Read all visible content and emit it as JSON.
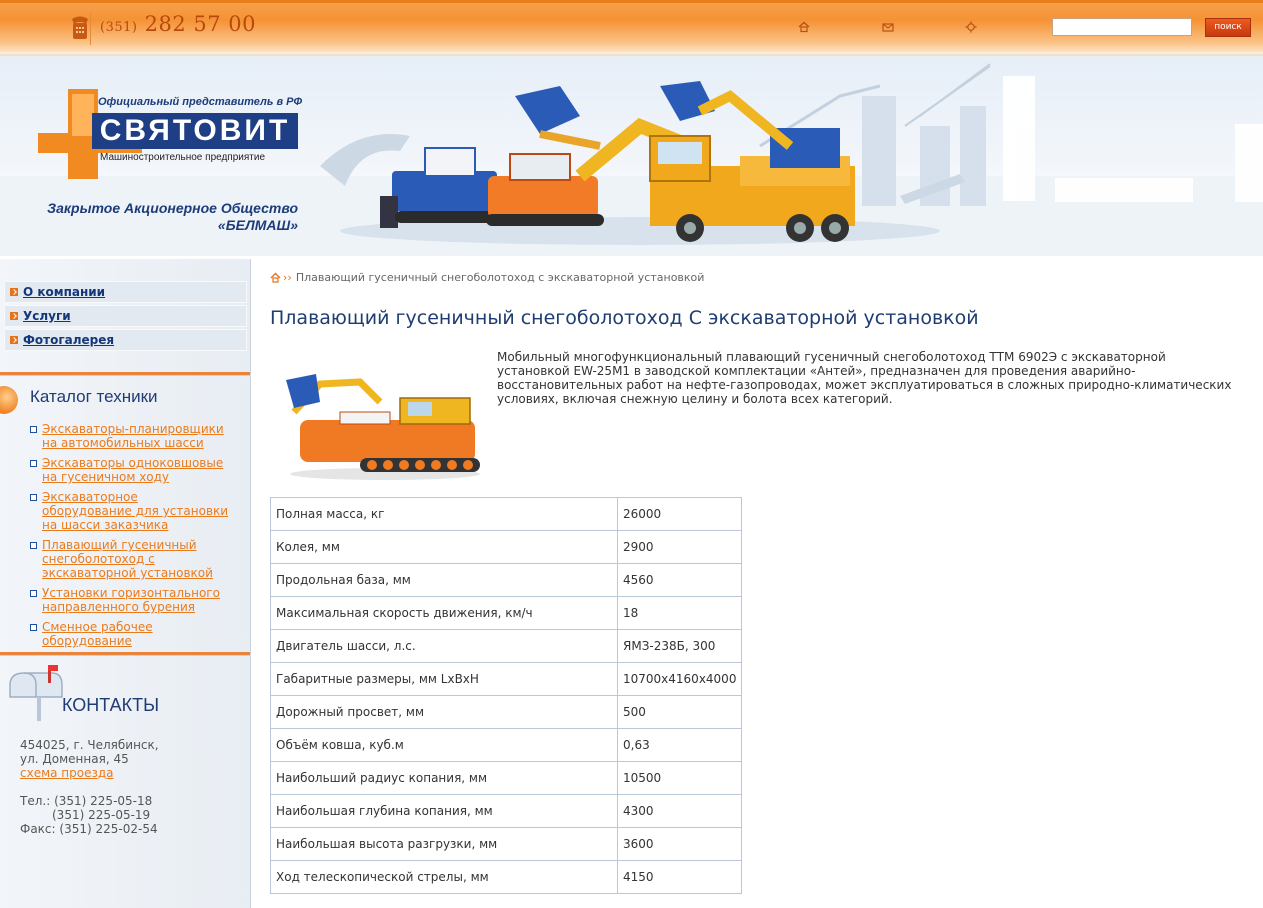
{
  "header": {
    "phone_code": "(351)",
    "phone_number": "282 57 00",
    "nav_icons": [
      "home-icon",
      "mail-icon",
      "sitemap-icon"
    ],
    "search_placeholder": "",
    "search_button": "поиск",
    "colors": {
      "accent": "#f59235",
      "brand_blue": "#1e3f86"
    }
  },
  "banner": {
    "logo_tagline": "Официальный представитель в РФ",
    "logo_word": "СВЯТОВИТ",
    "logo_subtitle": "Машиностроительное предприятие",
    "company_line1": "Закрытое Акционерное Общество",
    "company_line2": "«БЕЛМАШ»"
  },
  "sidebar": {
    "menu": [
      {
        "label": "О компании"
      },
      {
        "label": "Услуги"
      },
      {
        "label": "Фотогалерея"
      }
    ],
    "catalog_title": "Каталог техники",
    "catalog": [
      {
        "label": "Экскаваторы-планировщики на автомобильных шасси"
      },
      {
        "label": "Экскаваторы одноковшовые на гусеничном ходу"
      },
      {
        "label": "Экскаваторное оборудование для установки на шасси заказчика"
      },
      {
        "label": "Плавающий гусеничный снегоболотоход с экскаваторной установкой"
      },
      {
        "label": "Установки горизонтального направленного бурения"
      },
      {
        "label": "Сменное рабочее оборудование"
      }
    ],
    "contacts_title": "КОНТАКТЫ",
    "contacts": {
      "address1": "454025, г. Челябинск,",
      "address2": "ул. Доменная, 45",
      "map_link": "схема проезда",
      "tel_label": "Тел.:",
      "tel1": "(351) 225-05-18",
      "tel2": "(351) 225-05-19",
      "fax_label": "Факс:",
      "fax": "(351) 225-02-54"
    }
  },
  "main": {
    "breadcrumb_arrow": "››",
    "breadcrumb": "Плавающий гусеничный снегоболотоход с экскаваторной установкой",
    "title": "Плавающий гусеничный снегоболотоход С экскаваторной установкой",
    "intro": "Мобильный многофункциональный плавающий  гусеничный снегоболотоход ТТМ 6902Э с экскаваторной установкой EW-25M1 в заводской комплектации «Антей», предназначен для проведения аварийно-восстановительных работ на нефте-газопроводах, может эксплуатироваться в сложных природно-климатических условиях, включая снежную целину и болота всех категорий.",
    "specs": [
      {
        "key": "Полная масса, кг",
        "value": "26000"
      },
      {
        "key": "Колея, мм",
        "value": "2900"
      },
      {
        "key": "Продольная база, мм",
        "value": "4560"
      },
      {
        "key": "Максимальная скорость движения, км/ч",
        "value": "18"
      },
      {
        "key": "Двигатель шасси, л.с.",
        "value": "ЯМЗ-238Б, 300"
      },
      {
        "key": "Габаритные размеры, мм LxBxH",
        "value": "10700x4160x4000"
      },
      {
        "key": "Дорожный просвет, мм",
        "value": "500"
      },
      {
        "key": "Объём ковша, куб.м",
        "value": "0,63"
      },
      {
        "key": "Наибольший радиус копания, мм",
        "value": "10500"
      },
      {
        "key": "Наибольшая глубина копания, мм",
        "value": "4300"
      },
      {
        "key": "Наибольшая высота разгрузки, мм",
        "value": "3600"
      },
      {
        "key": "Ход телескопической стрелы, мм",
        "value": "4150"
      }
    ]
  }
}
